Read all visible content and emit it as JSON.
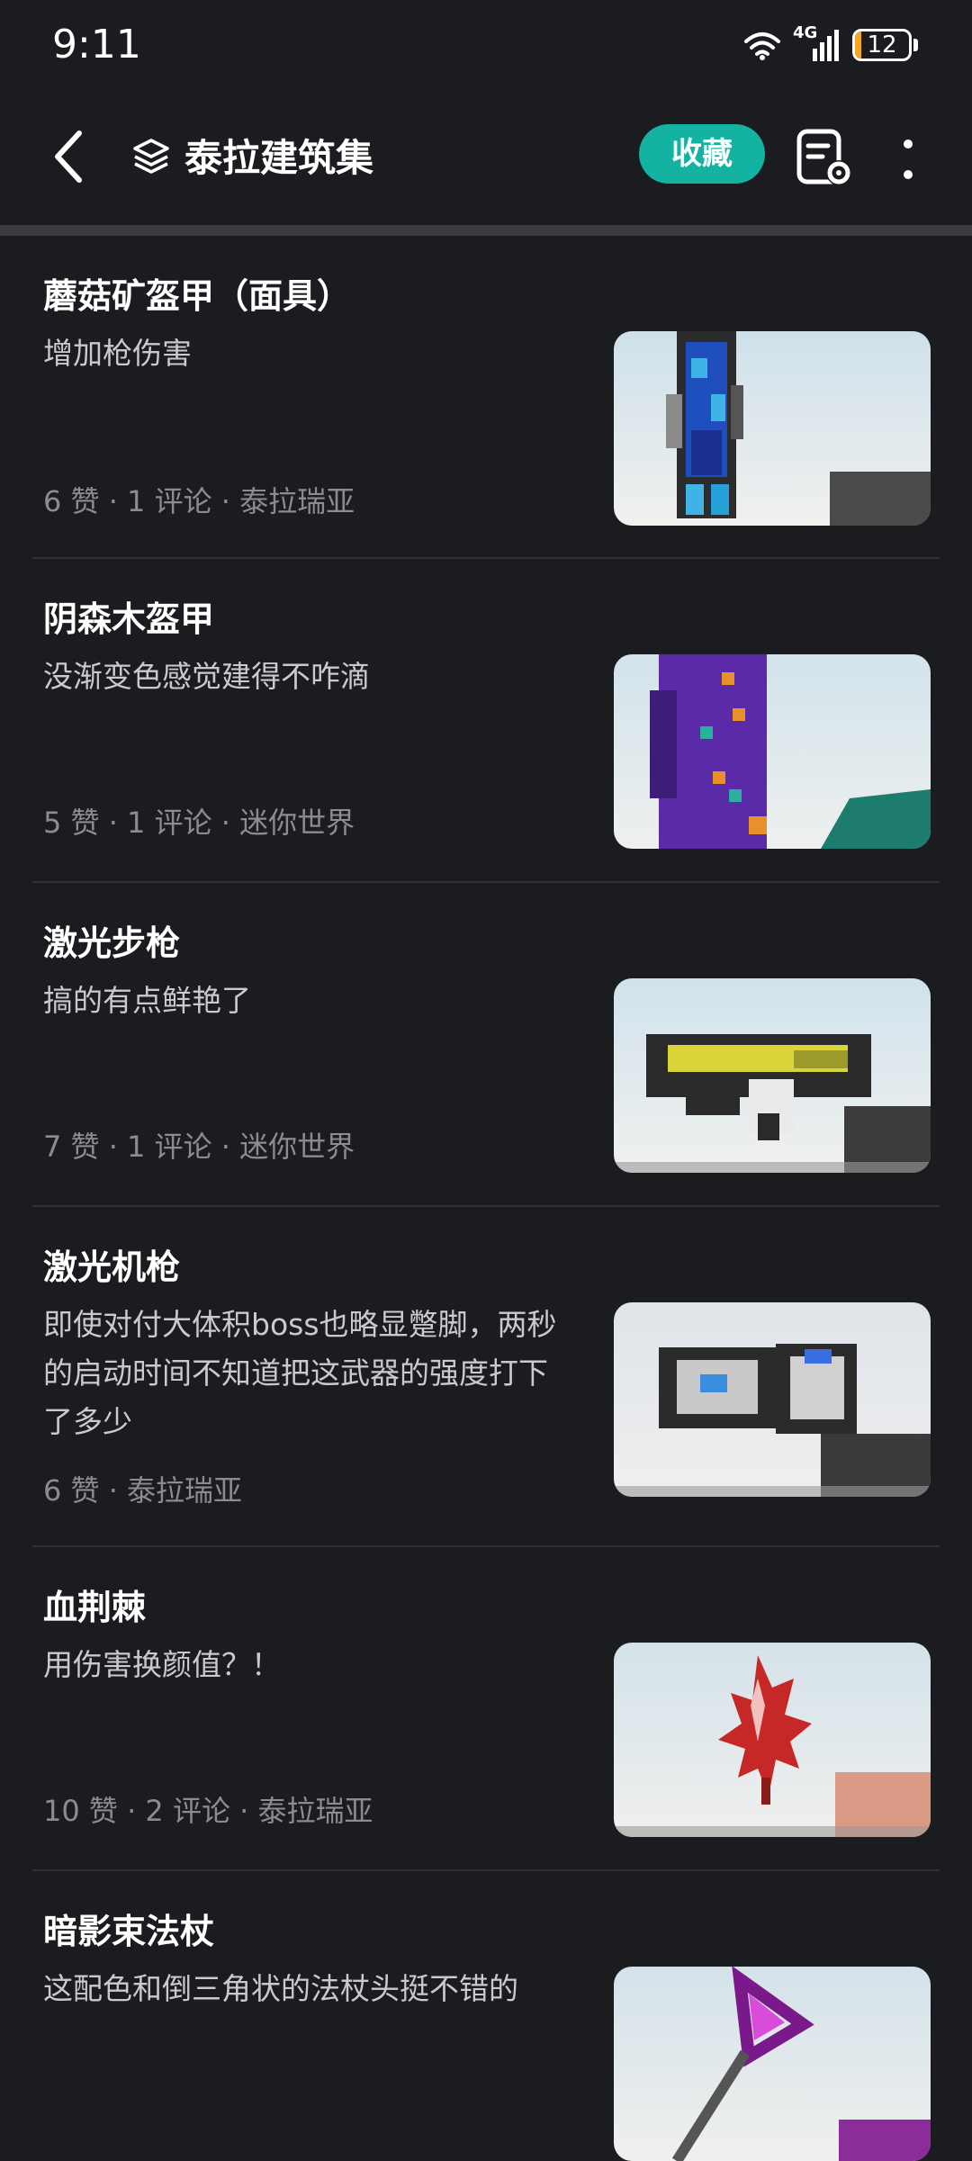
{
  "status_bar": {
    "time": "9:11",
    "network_label": "4G",
    "battery_level": "12",
    "battery_fraction": 0.12,
    "icons": [
      "wifi-icon",
      "signal-icon",
      "battery-icon"
    ]
  },
  "app_bar": {
    "title": "泰拉建筑集",
    "collect_label": "收藏",
    "icons": [
      "back-icon",
      "layers-icon",
      "doc-settings-icon",
      "more-icon"
    ]
  },
  "colors": {
    "background": "#1b1c20",
    "accent": "#14b3a1",
    "meta_text": "#8b8c92"
  },
  "posts": [
    {
      "title": "蘑菇矿盔甲（面具）",
      "description": "增加枪伤害",
      "meta": "6 赞 · 1 评论 · 泰拉瑞亚"
    },
    {
      "title": "阴森木盔甲",
      "description": "没渐变色感觉建得不咋滴",
      "meta": "5 赞 · 1 评论 · 迷你世界"
    },
    {
      "title": "激光步枪",
      "description": "搞的有点鲜艳了",
      "meta": "7 赞 · 1 评论 · 迷你世界"
    },
    {
      "title": "激光机枪",
      "description": "即使对付大体积boss也略显蹩脚，两秒的启动时间不知道把这武器的强度打下了多少",
      "meta": "6 赞 · 泰拉瑞亚"
    },
    {
      "title": "血荆棘",
      "description": "用伤害换颜值？！",
      "meta": "10 赞 · 2 评论 · 泰拉瑞亚"
    },
    {
      "title": "暗影束法杖",
      "description": "这配色和倒三角状的法杖头挺不错的",
      "meta": ""
    }
  ]
}
